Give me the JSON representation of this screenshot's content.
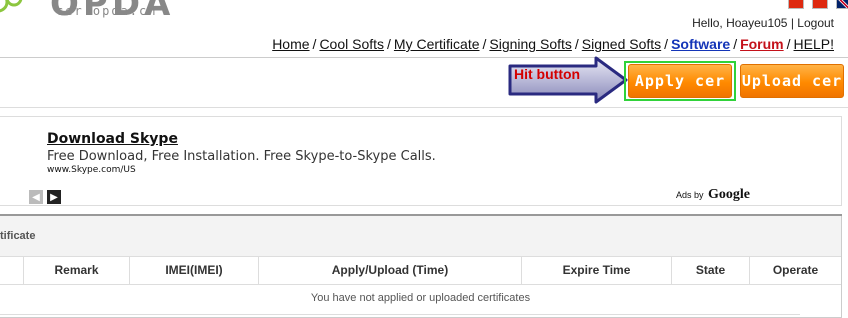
{
  "logo": {
    "text": "OPDA",
    "subtitle": "cer.opda.cn"
  },
  "header": {
    "greeting": "Hello, Hoayeu105",
    "separator": "|",
    "logout": "Logout"
  },
  "nav": {
    "items": [
      {
        "label": "Home"
      },
      {
        "label": "Cool Softs"
      },
      {
        "label": "My Certificate"
      },
      {
        "label": "Signing Softs"
      },
      {
        "label": "Signed Softs"
      },
      {
        "label": "Software"
      },
      {
        "label": "Forum"
      },
      {
        "label": "HELP!"
      }
    ],
    "separator": "/"
  },
  "toolbar": {
    "annotation": "Hit button",
    "apply_label": "Apply cer",
    "upload_label": "Upload cer"
  },
  "ad": {
    "title": "Download Skype",
    "description": "Free Download, Free Installation. Free Skype-to-Skype Calls.",
    "url": "www.Skype.com/US",
    "ads_by": "Ads by",
    "google": "Google"
  },
  "certificates": {
    "title": "tificate",
    "columns": [
      "",
      "Remark",
      "IMEI(IMEI)",
      "Apply/Upload (Time)",
      "Expire Time",
      "State",
      "Operate"
    ],
    "empty_message": "You have not applied or uploaded certificates"
  },
  "colors": {
    "accent_orange": "#ff8a00",
    "highlight_green": "#30d23a",
    "arrow_blue": "#3a3a9a",
    "annotation_red": "#d40000",
    "nav_software": "#1435b8",
    "nav_forum": "#c4111a"
  }
}
